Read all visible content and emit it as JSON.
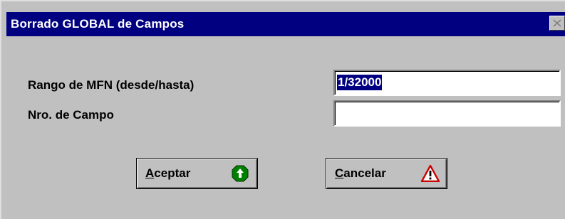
{
  "window": {
    "title": "Borrado GLOBAL de Campos",
    "close_icon": "close-icon"
  },
  "form": {
    "mfn_range": {
      "label": "Rango de MFN (desde/hasta)",
      "value": "1/32000",
      "selected": true
    },
    "field_number": {
      "label": "Nro. de Campo",
      "value": ""
    }
  },
  "buttons": {
    "accept": {
      "mnemonic": "A",
      "rest": "ceptar",
      "icon": "green-up-arrow-icon"
    },
    "cancel": {
      "mnemonic": "C",
      "rest": "ancelar",
      "icon": "warning-triangle-icon"
    }
  },
  "colors": {
    "titlebar": "#000080",
    "dialog_bg": "#c0c0c0",
    "accept_icon": "#008000",
    "cancel_icon": "#cc0000"
  }
}
